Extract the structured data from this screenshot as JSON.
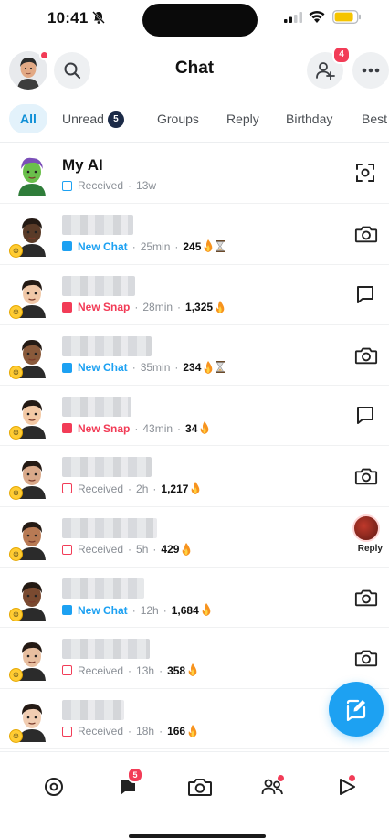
{
  "status_bar": {
    "time": "10:41"
  },
  "header": {
    "title": "Chat",
    "add_friend_badge": "4"
  },
  "tabs": [
    {
      "label": "All",
      "active": true
    },
    {
      "label": "Unread",
      "count": "5"
    },
    {
      "label": "Groups"
    },
    {
      "label": "Reply"
    },
    {
      "label": "Birthday"
    },
    {
      "label": "Best"
    }
  ],
  "chats": [
    {
      "name": "My AI",
      "status": "Received",
      "time": "13w",
      "streak": "",
      "action": "scan-icon",
      "avatar_color": "#6abf4b"
    },
    {
      "name": "",
      "status": "New Chat",
      "time": "25min",
      "streak": "245",
      "hourglass": true,
      "action": "camera-icon",
      "avatar_color": "#5a3b28"
    },
    {
      "name": "",
      "status": "New Snap",
      "time": "28min",
      "streak": "1,325",
      "action": "chat-bubble-icon",
      "avatar_color": "#f0c8a8"
    },
    {
      "name": "",
      "status": "New Chat",
      "time": "35min",
      "streak": "234",
      "hourglass": true,
      "action": "camera-icon",
      "avatar_color": "#8a5a3b"
    },
    {
      "name": "",
      "status": "New Snap",
      "time": "43min",
      "streak": "34",
      "action": "chat-bubble-icon",
      "avatar_color": "#f3c9a5"
    },
    {
      "name": "",
      "status": "Received",
      "time": "2h",
      "streak": "1,217",
      "action": "camera-icon",
      "avatar_color": "#d9a98a"
    },
    {
      "name": "",
      "status": "Received",
      "time": "5h",
      "streak": "429",
      "action": "reply",
      "reply_label": "Reply",
      "avatar_color": "#b87a54"
    },
    {
      "name": "",
      "status": "New Chat",
      "time": "12h",
      "streak": "1,684",
      "action": "camera-icon",
      "avatar_color": "#7a4a30"
    },
    {
      "name": "",
      "status": "Received",
      "time": "13h",
      "streak": "358",
      "action": "camera-icon",
      "avatar_color": "#e8bfa0"
    },
    {
      "name": "",
      "status": "Received",
      "time": "18h",
      "streak": "166",
      "action": "camera-icon",
      "avatar_color": "#f1cdb2"
    }
  ],
  "bottom_nav": {
    "chat_badge": "5",
    "items": [
      "map-icon",
      "chat-icon",
      "camera-icon",
      "friends-icon",
      "spotlight-icon"
    ]
  },
  "colors": {
    "accent_blue": "#1da1f2",
    "snap_red": "#f23c57",
    "tab_active_bg": "#e3f2fb"
  }
}
